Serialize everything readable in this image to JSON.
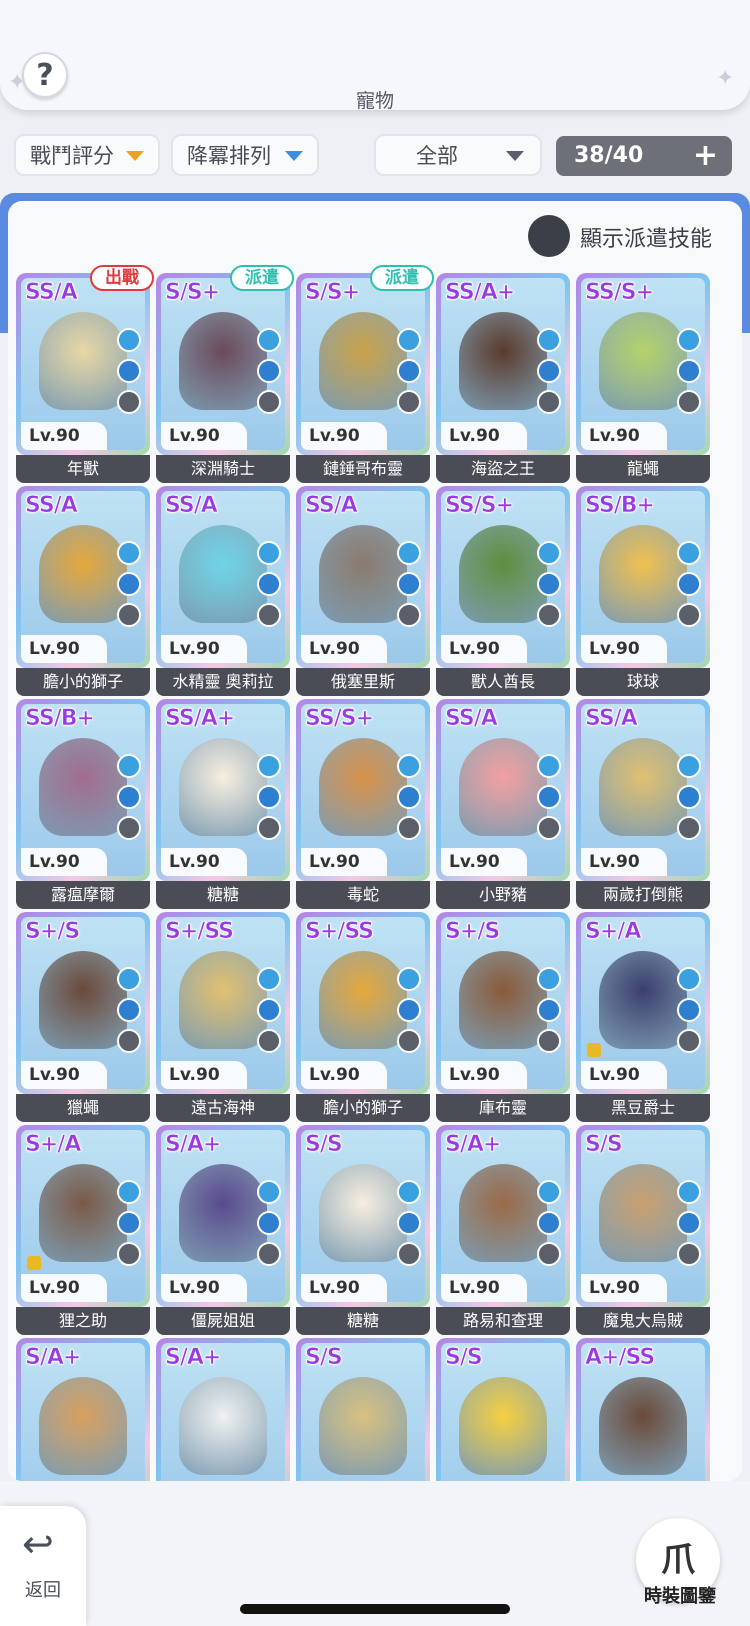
{
  "header": {
    "title": "寵物",
    "help_icon": "?"
  },
  "filters": {
    "sort_by": "戰鬥評分",
    "order": "降冪排列",
    "category": "全部",
    "count": "38/40",
    "add_icon": "+"
  },
  "toggle": {
    "label": "顯示派遣技能",
    "state": "off"
  },
  "pets": [
    {
      "rank": "SS/A",
      "level": "Lv.90",
      "name": "年獸",
      "badge": "出戰",
      "badge_type": "out",
      "color": "#e8d7a5",
      "locked": false
    },
    {
      "rank": "S/S+",
      "level": "Lv.90",
      "name": "深淵騎士",
      "badge": "派遣",
      "badge_type": "disp",
      "color": "#6b4a5a",
      "locked": false
    },
    {
      "rank": "S/S+",
      "level": "Lv.90",
      "name": "鏈錘哥布靈",
      "badge": "派遣",
      "badge_type": "disp",
      "color": "#c9a24a",
      "locked": false
    },
    {
      "rank": "SS/A+",
      "level": "Lv.90",
      "name": "海盜之王",
      "badge": "",
      "badge_type": "",
      "color": "#5a3b2e",
      "locked": false
    },
    {
      "rank": "SS/S+",
      "level": "Lv.90",
      "name": "龍蠅",
      "badge": "",
      "badge_type": "",
      "color": "#b4d36a",
      "locked": false
    },
    {
      "rank": "SS/A",
      "level": "Lv.90",
      "name": "膽小的獅子",
      "badge": "",
      "badge_type": "",
      "color": "#e6a83c",
      "locked": false
    },
    {
      "rank": "SS/A",
      "level": "Lv.90",
      "name": "水精靈 奧莉拉",
      "badge": "",
      "badge_type": "",
      "color": "#6fd4e8",
      "locked": false
    },
    {
      "rank": "SS/A",
      "level": "Lv.90",
      "name": "俄塞里斯",
      "badge": "",
      "badge_type": "",
      "color": "#8a7a6e",
      "locked": false
    },
    {
      "rank": "SS/S+",
      "level": "Lv.90",
      "name": "獸人酋長",
      "badge": "",
      "badge_type": "",
      "color": "#5e8f3e",
      "locked": false
    },
    {
      "rank": "SS/B+",
      "level": "Lv.90",
      "name": "球球",
      "badge": "",
      "badge_type": "",
      "color": "#f0c050",
      "locked": false
    },
    {
      "rank": "SS/B+",
      "level": "Lv.90",
      "name": "露瘟摩爾",
      "badge": "",
      "badge_type": "",
      "color": "#a06c8e",
      "locked": false
    },
    {
      "rank": "SS/A+",
      "level": "Lv.90",
      "name": "糖糖",
      "badge": "",
      "badge_type": "",
      "color": "#f7eee0",
      "locked": false
    },
    {
      "rank": "SS/S+",
      "level": "Lv.90",
      "name": "毒蛇",
      "badge": "",
      "badge_type": "",
      "color": "#d9924a",
      "locked": false
    },
    {
      "rank": "SS/A",
      "level": "Lv.90",
      "name": "小野豬",
      "badge": "",
      "badge_type": "",
      "color": "#f2a0a0",
      "locked": false
    },
    {
      "rank": "SS/A",
      "level": "Lv.90",
      "name": "兩歲打倒熊",
      "badge": "",
      "badge_type": "",
      "color": "#e0c070",
      "locked": false
    },
    {
      "rank": "S+/S",
      "level": "Lv.90",
      "name": "獵蠅",
      "badge": "",
      "badge_type": "",
      "color": "#6b4a3a",
      "locked": false
    },
    {
      "rank": "S+/SS",
      "level": "Lv.90",
      "name": "遠古海神",
      "badge": "",
      "badge_type": "",
      "color": "#e0c070",
      "locked": false
    },
    {
      "rank": "S+/SS",
      "level": "Lv.90",
      "name": "膽小的獅子",
      "badge": "",
      "badge_type": "",
      "color": "#e6a83c",
      "locked": false
    },
    {
      "rank": "S+/S",
      "level": "Lv.90",
      "name": "庫布靈",
      "badge": "",
      "badge_type": "",
      "color": "#8a5a3a",
      "locked": false
    },
    {
      "rank": "S+/A",
      "level": "Lv.90",
      "name": "黑豆爵士",
      "badge": "",
      "badge_type": "",
      "color": "#3a3f6e",
      "locked": true
    },
    {
      "rank": "S+/A",
      "level": "Lv.90",
      "name": "狸之助",
      "badge": "",
      "badge_type": "",
      "color": "#7a5a48",
      "locked": true
    },
    {
      "rank": "S/A+",
      "level": "Lv.90",
      "name": "僵屍姐姐",
      "badge": "",
      "badge_type": "",
      "color": "#5a4a8e",
      "locked": false
    },
    {
      "rank": "S/S",
      "level": "Lv.90",
      "name": "糖糖",
      "badge": "",
      "badge_type": "",
      "color": "#f7eee0",
      "locked": false
    },
    {
      "rank": "S/A+",
      "level": "Lv.90",
      "name": "路易和查理",
      "badge": "",
      "badge_type": "",
      "color": "#9a6a48",
      "locked": false
    },
    {
      "rank": "S/S",
      "level": "Lv.90",
      "name": "魔鬼大烏賊",
      "badge": "",
      "badge_type": "",
      "color": "#c8a070",
      "locked": false
    },
    {
      "rank": "S/A+",
      "level": "",
      "name": "",
      "badge": "",
      "badge_type": "",
      "color": "#d8a060",
      "locked": false
    },
    {
      "rank": "S/A+",
      "level": "",
      "name": "",
      "badge": "",
      "badge_type": "",
      "color": "#f0f0f0",
      "locked": false
    },
    {
      "rank": "S/S",
      "level": "",
      "name": "",
      "badge": "",
      "badge_type": "",
      "color": "#d8c080",
      "locked": false
    },
    {
      "rank": "S/S",
      "level": "",
      "name": "",
      "badge": "",
      "badge_type": "",
      "color": "#f5d040",
      "locked": false
    },
    {
      "rank": "A+/SS",
      "level": "",
      "name": "",
      "badge": "",
      "badge_type": "",
      "color": "#6a4a3a",
      "locked": false
    }
  ],
  "skill_icon_colors": [
    "#3aa0e0",
    "#2f7fd0",
    "#5a5f6a"
  ],
  "bottom": {
    "back_label": "返回",
    "back_icon": "↩",
    "fashion_label": "時裝圖鑒",
    "fashion_icon": "爪"
  }
}
